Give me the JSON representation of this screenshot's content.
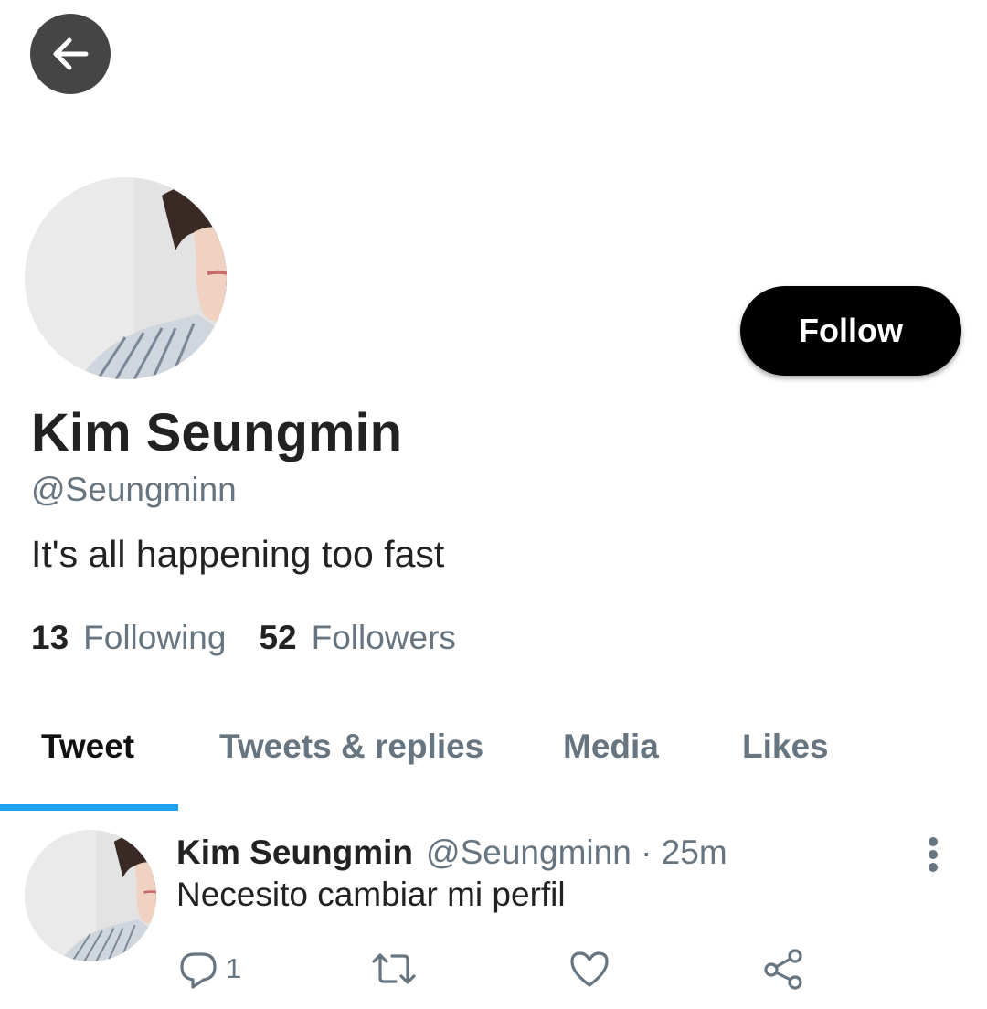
{
  "header": {
    "back_icon": "arrow-left-icon"
  },
  "profile": {
    "display_name": "Kim Seungmin",
    "handle": "@Seungminn",
    "bio": "It's all happening too fast",
    "follow_label": "Follow",
    "following_count": "13",
    "following_label": "Following",
    "followers_count": "52",
    "followers_label": "Followers"
  },
  "tabs": [
    {
      "label": "Tweet",
      "active": true
    },
    {
      "label": "Tweets & replies",
      "active": false
    },
    {
      "label": "Media",
      "active": false
    },
    {
      "label": "Likes",
      "active": false
    }
  ],
  "tweet": {
    "name": "Kim Seungmin",
    "handle": "@Seungminn",
    "separator": "·",
    "time": "25m",
    "text": "Necesito cambiar mi perfil",
    "reply_count": "1",
    "icons": [
      "reply-icon",
      "retweet-icon",
      "like-icon",
      "share-icon",
      "more-vertical-icon"
    ]
  },
  "colors": {
    "accent": "#1da1f2",
    "follow_bg": "#000000",
    "secondary_text": "#66757f",
    "primary_text": "#222222"
  }
}
